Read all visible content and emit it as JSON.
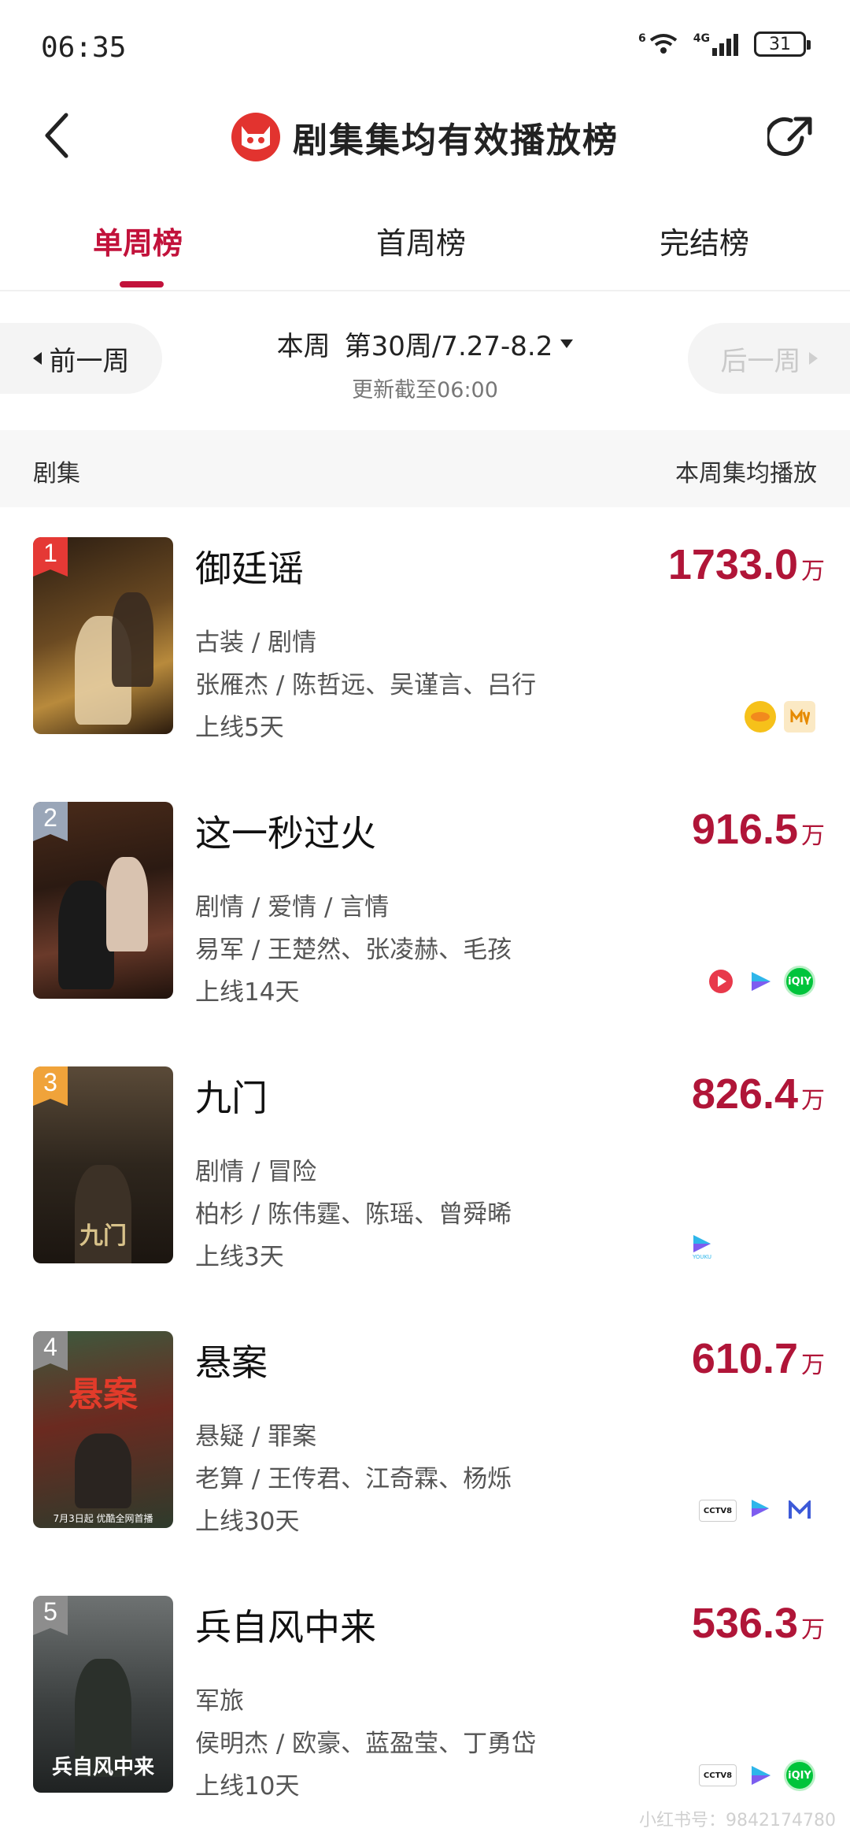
{
  "status": {
    "time": "06:35",
    "wifi": "6",
    "network": "4G",
    "battery": "31"
  },
  "header": {
    "title": "剧集集均有效播放榜"
  },
  "tabs": [
    {
      "label": "单周榜",
      "active": true
    },
    {
      "label": "首周榜",
      "active": false
    },
    {
      "label": "完结榜",
      "active": false
    }
  ],
  "week": {
    "prev": "前一周",
    "next": "后一周",
    "label": "本周",
    "period": "第30周/7.27-8.2",
    "updated": "更新截至06:00"
  },
  "columns": {
    "left": "剧集",
    "right": "本周集均播放"
  },
  "items": [
    {
      "rank": "1",
      "title": "御廷谣",
      "genre": "古装 / 剧情",
      "cast": "张雁杰 / 陈哲远、吴谨言、吕行",
      "online": "上线5天",
      "value": "1733.0",
      "unit": "万",
      "rank_color": "#e53935",
      "platforms": [
        "mango-icon",
        "mgtv-icon"
      ]
    },
    {
      "rank": "2",
      "title": "这一秒过火",
      "genre": "剧情 / 爱情 / 言情",
      "cast": "易军 / 王楚然、张凌赫、毛孩",
      "online": "上线14天",
      "value": "916.5",
      "unit": "万",
      "rank_color": "#9aa6b8",
      "platforms": [
        "tencent-video-icon",
        "youku-icon",
        "iqiyi-icon"
      ]
    },
    {
      "rank": "3",
      "title": "九门",
      "genre": "剧情 / 冒险",
      "cast": "柏杉 / 陈伟霆、陈瑶、曾舜晞",
      "online": "上线3天",
      "value": "826.4",
      "unit": "万",
      "rank_color": "#f0a33a",
      "platforms": [
        "youku-icon"
      ]
    },
    {
      "rank": "4",
      "title": "悬案",
      "genre": "悬疑 / 罪案",
      "cast": "老算 / 王传君、江奇霖、杨烁",
      "online": "上线30天",
      "value": "610.7",
      "unit": "万",
      "rank_color": "#8d8d8d",
      "platforms": [
        "cctv8-icon",
        "youku-icon",
        "migu-icon"
      ],
      "poster_text": "7月3日起 优酷全网首播"
    },
    {
      "rank": "5",
      "title": "兵自风中来",
      "genre": "军旅",
      "cast": "侯明杰 / 欧豪、蓝盈莹、丁勇岱",
      "online": "上线10天",
      "value": "536.3",
      "unit": "万",
      "rank_color": "#8d8d8d",
      "platforms": [
        "cctv8-icon",
        "youku-icon",
        "iqiyi-icon"
      ]
    }
  ],
  "watermark": "小红书号：9842174780"
}
